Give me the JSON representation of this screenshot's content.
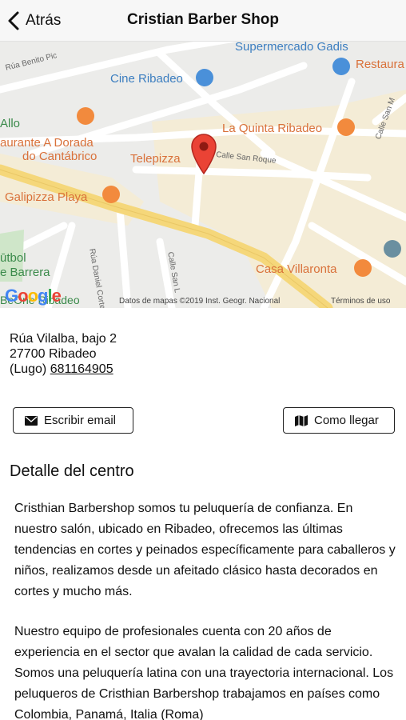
{
  "header": {
    "back_label": "Atrás",
    "title": "Cristian Barber Shop"
  },
  "map": {
    "labels": {
      "supermarket": "Supermercado Gadis",
      "restaurant_right": "Restaura",
      "cinema": "Cine Ribadeo",
      "la_quinta": "La Quinta Ribadeo",
      "allo": "Allo",
      "a_dorada_1": "aurante A Dorada",
      "a_dorada_2": "do Cantábrico",
      "telepizza": "Telepizza",
      "galipizza": "Galipizza Playa",
      "futbol": "ūtbol",
      "barrera": "e Barrera",
      "villaronta": "Casa Villaronta",
      "bedhe": "BeOne Ribadeo"
    },
    "streets": {
      "benito": "Rúa Benito Pic",
      "san_roque": "Calle San Roque",
      "daniel": "Rúa Daniel Corte",
      "san_l": "Calle San L",
      "san_m": "Calle San M"
    },
    "google_logo": "Google",
    "attribution": "Datos de mapas ©2019 Inst. Geogr. Nacional",
    "terms": "Términos de uso",
    "colors": {
      "pin": "#ea4335",
      "poi_food": "#f28a3d",
      "poi_blue": "#4a90d9",
      "road_main": "#f5d77a"
    }
  },
  "address": {
    "line1": "Rúa Vilalba, bajo 2",
    "line2": "27700 Ribadeo",
    "line3": "(Lugo)",
    "phone": "681164905"
  },
  "actions": {
    "email_label": "Escribir email",
    "route_label": "Como llegar"
  },
  "detail": {
    "title": "Detalle del centro",
    "paragraph1": "Cristhian Barbershop somos tu peluquería de confianza. En nuestro salón, ubicado en Ribadeo, ofrecemos las últimas tendencias en cortes y peinados específicamente para caballeros y niños, realizamos desde un afeitado clásico hasta decorados en cortes y mucho más.",
    "paragraph2": "Nuestro equipo de profesionales cuenta con 20 años de experiencia en el sector que avalan la calidad de cada servicio. Somos una peluquería latina con una trayectoria internacional. Los peluqueros de Cristhian Barbershop trabajamos en países como Colombia, Panamá, Italia (Roma)"
  }
}
